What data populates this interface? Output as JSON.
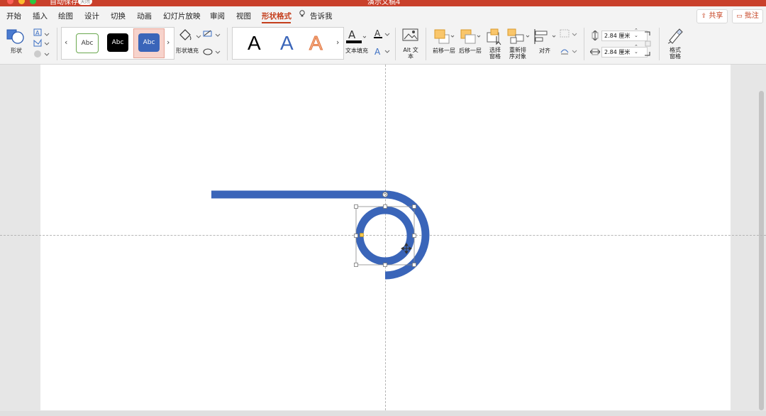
{
  "titlebar": {
    "autosave_label": "自动保存",
    "autosave_toggle": "关闭",
    "document_title": "演示文稿4"
  },
  "menu": {
    "tabs": [
      {
        "label": "开始"
      },
      {
        "label": "插入"
      },
      {
        "label": "绘图"
      },
      {
        "label": "设计"
      },
      {
        "label": "切换"
      },
      {
        "label": "动画"
      },
      {
        "label": "幻灯片放映"
      },
      {
        "label": "审阅"
      },
      {
        "label": "视图"
      },
      {
        "label": "形状格式",
        "active": true
      }
    ],
    "tell_me": "告诉我",
    "share": "共享",
    "comments": "批注"
  },
  "ribbon": {
    "shape_label": "形状",
    "shape_styles": [
      {
        "label": "Abc",
        "variant": "outline-green"
      },
      {
        "label": "Abc",
        "variant": "black"
      },
      {
        "label": "Abc",
        "variant": "blue-selected"
      }
    ],
    "shape_fill": "形状填充",
    "text_fill": "文本填充",
    "wordart_letter": "A",
    "alt_text": "Alt 文本",
    "bring_forward": "前移一层",
    "send_backward": "后移一层",
    "selection_pane": "选择窗格",
    "reorder_objects": "重新排序对象",
    "align": "对齐",
    "height_value": "2.84 厘米",
    "width_value": "2.84 厘米",
    "format_pane": "格式窗格"
  },
  "colors": {
    "accent": "#c43e1c",
    "shape_blue": "#3a65b9",
    "titlebar": "#c9402b"
  }
}
